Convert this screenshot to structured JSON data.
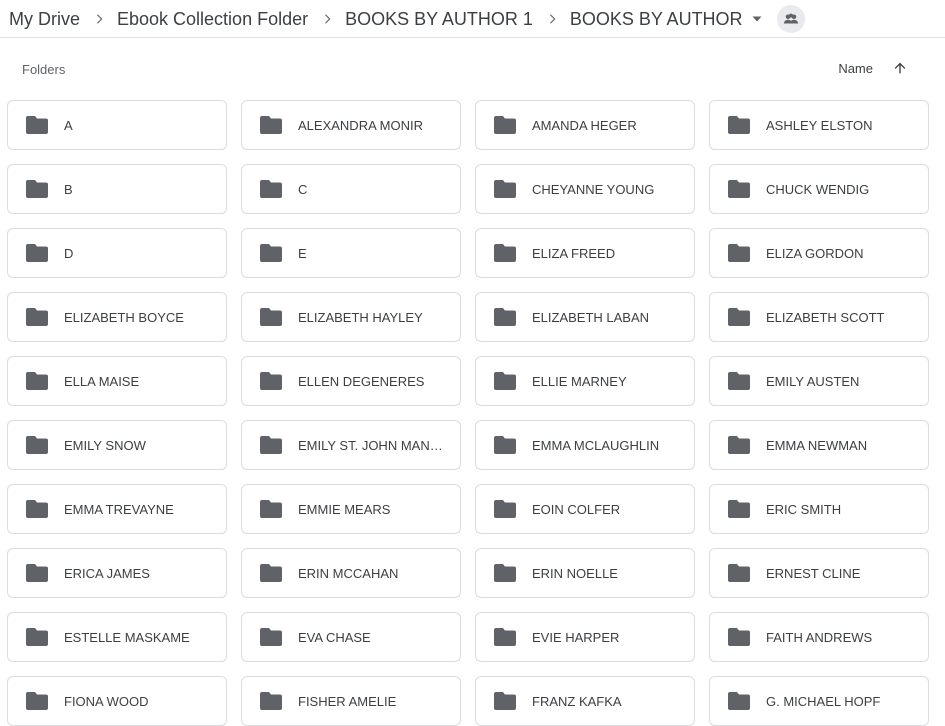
{
  "breadcrumb": {
    "items": [
      "My Drive",
      "Ebook Collection Folder",
      "BOOKS BY AUTHOR 1",
      "BOOKS BY AUTHOR"
    ],
    "current_has_dropdown": true,
    "shared_icon": "shared-people-icon"
  },
  "section": {
    "label": "Folders",
    "sort_label": "Name",
    "sort_direction_icon": "arrow-up-icon"
  },
  "colors": {
    "icon_gray": "#5f6368",
    "border": "#dadce0",
    "text": "#3c4043"
  },
  "folders": [
    "A",
    "ALEXANDRA MONIR",
    "AMANDA HEGER",
    "ASHLEY ELSTON",
    "B",
    "C",
    "CHEYANNE YOUNG",
    "CHUCK WENDIG",
    "D",
    "E",
    "ELIZA FREED",
    "ELIZA GORDON",
    "ELIZABETH BOYCE",
    "ELIZABETH HAYLEY",
    "ELIZABETH LABAN",
    "ELIZABETH SCOTT",
    "ELLA MAISE",
    "ELLEN DEGENERES",
    "ELLIE MARNEY",
    "EMILY AUSTEN",
    "EMILY SNOW",
    "EMILY ST. JOHN MAND...",
    "EMMA MCLAUGHLIN",
    "EMMA NEWMAN",
    "EMMA TREVAYNE",
    "EMMIE MEARS",
    "EOIN COLFER",
    "ERIC SMITH",
    "ERICA JAMES",
    "ERIN MCCAHAN",
    "ERIN NOELLE",
    "ERNEST CLINE",
    "ESTELLE MASKAME",
    "EVA CHASE",
    "EVIE HARPER",
    "FAITH ANDREWS",
    "FIONA WOOD",
    "FISHER AMELIE",
    "FRANZ KAFKA",
    "G. MICHAEL HOPF"
  ]
}
